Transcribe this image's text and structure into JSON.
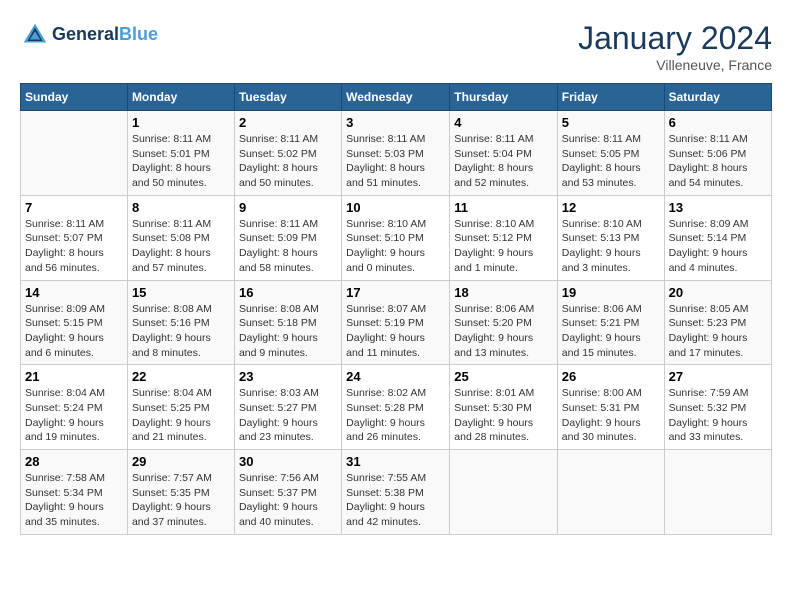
{
  "header": {
    "logo_line1": "General",
    "logo_line2": "Blue",
    "title": "January 2024",
    "location": "Villeneuve, France"
  },
  "columns": [
    "Sunday",
    "Monday",
    "Tuesday",
    "Wednesday",
    "Thursday",
    "Friday",
    "Saturday"
  ],
  "weeks": [
    [
      {
        "day": "",
        "sunrise": "",
        "sunset": "",
        "daylight": ""
      },
      {
        "day": "1",
        "sunrise": "Sunrise: 8:11 AM",
        "sunset": "Sunset: 5:01 PM",
        "daylight": "Daylight: 8 hours and 50 minutes."
      },
      {
        "day": "2",
        "sunrise": "Sunrise: 8:11 AM",
        "sunset": "Sunset: 5:02 PM",
        "daylight": "Daylight: 8 hours and 50 minutes."
      },
      {
        "day": "3",
        "sunrise": "Sunrise: 8:11 AM",
        "sunset": "Sunset: 5:03 PM",
        "daylight": "Daylight: 8 hours and 51 minutes."
      },
      {
        "day": "4",
        "sunrise": "Sunrise: 8:11 AM",
        "sunset": "Sunset: 5:04 PM",
        "daylight": "Daylight: 8 hours and 52 minutes."
      },
      {
        "day": "5",
        "sunrise": "Sunrise: 8:11 AM",
        "sunset": "Sunset: 5:05 PM",
        "daylight": "Daylight: 8 hours and 53 minutes."
      },
      {
        "day": "6",
        "sunrise": "Sunrise: 8:11 AM",
        "sunset": "Sunset: 5:06 PM",
        "daylight": "Daylight: 8 hours and 54 minutes."
      }
    ],
    [
      {
        "day": "7",
        "sunrise": "Sunrise: 8:11 AM",
        "sunset": "Sunset: 5:07 PM",
        "daylight": "Daylight: 8 hours and 56 minutes."
      },
      {
        "day": "8",
        "sunrise": "Sunrise: 8:11 AM",
        "sunset": "Sunset: 5:08 PM",
        "daylight": "Daylight: 8 hours and 57 minutes."
      },
      {
        "day": "9",
        "sunrise": "Sunrise: 8:11 AM",
        "sunset": "Sunset: 5:09 PM",
        "daylight": "Daylight: 8 hours and 58 minutes."
      },
      {
        "day": "10",
        "sunrise": "Sunrise: 8:10 AM",
        "sunset": "Sunset: 5:10 PM",
        "daylight": "Daylight: 9 hours and 0 minutes."
      },
      {
        "day": "11",
        "sunrise": "Sunrise: 8:10 AM",
        "sunset": "Sunset: 5:12 PM",
        "daylight": "Daylight: 9 hours and 1 minute."
      },
      {
        "day": "12",
        "sunrise": "Sunrise: 8:10 AM",
        "sunset": "Sunset: 5:13 PM",
        "daylight": "Daylight: 9 hours and 3 minutes."
      },
      {
        "day": "13",
        "sunrise": "Sunrise: 8:09 AM",
        "sunset": "Sunset: 5:14 PM",
        "daylight": "Daylight: 9 hours and 4 minutes."
      }
    ],
    [
      {
        "day": "14",
        "sunrise": "Sunrise: 8:09 AM",
        "sunset": "Sunset: 5:15 PM",
        "daylight": "Daylight: 9 hours and 6 minutes."
      },
      {
        "day": "15",
        "sunrise": "Sunrise: 8:08 AM",
        "sunset": "Sunset: 5:16 PM",
        "daylight": "Daylight: 9 hours and 8 minutes."
      },
      {
        "day": "16",
        "sunrise": "Sunrise: 8:08 AM",
        "sunset": "Sunset: 5:18 PM",
        "daylight": "Daylight: 9 hours and 9 minutes."
      },
      {
        "day": "17",
        "sunrise": "Sunrise: 8:07 AM",
        "sunset": "Sunset: 5:19 PM",
        "daylight": "Daylight: 9 hours and 11 minutes."
      },
      {
        "day": "18",
        "sunrise": "Sunrise: 8:06 AM",
        "sunset": "Sunset: 5:20 PM",
        "daylight": "Daylight: 9 hours and 13 minutes."
      },
      {
        "day": "19",
        "sunrise": "Sunrise: 8:06 AM",
        "sunset": "Sunset: 5:21 PM",
        "daylight": "Daylight: 9 hours and 15 minutes."
      },
      {
        "day": "20",
        "sunrise": "Sunrise: 8:05 AM",
        "sunset": "Sunset: 5:23 PM",
        "daylight": "Daylight: 9 hours and 17 minutes."
      }
    ],
    [
      {
        "day": "21",
        "sunrise": "Sunrise: 8:04 AM",
        "sunset": "Sunset: 5:24 PM",
        "daylight": "Daylight: 9 hours and 19 minutes."
      },
      {
        "day": "22",
        "sunrise": "Sunrise: 8:04 AM",
        "sunset": "Sunset: 5:25 PM",
        "daylight": "Daylight: 9 hours and 21 minutes."
      },
      {
        "day": "23",
        "sunrise": "Sunrise: 8:03 AM",
        "sunset": "Sunset: 5:27 PM",
        "daylight": "Daylight: 9 hours and 23 minutes."
      },
      {
        "day": "24",
        "sunrise": "Sunrise: 8:02 AM",
        "sunset": "Sunset: 5:28 PM",
        "daylight": "Daylight: 9 hours and 26 minutes."
      },
      {
        "day": "25",
        "sunrise": "Sunrise: 8:01 AM",
        "sunset": "Sunset: 5:30 PM",
        "daylight": "Daylight: 9 hours and 28 minutes."
      },
      {
        "day": "26",
        "sunrise": "Sunrise: 8:00 AM",
        "sunset": "Sunset: 5:31 PM",
        "daylight": "Daylight: 9 hours and 30 minutes."
      },
      {
        "day": "27",
        "sunrise": "Sunrise: 7:59 AM",
        "sunset": "Sunset: 5:32 PM",
        "daylight": "Daylight: 9 hours and 33 minutes."
      }
    ],
    [
      {
        "day": "28",
        "sunrise": "Sunrise: 7:58 AM",
        "sunset": "Sunset: 5:34 PM",
        "daylight": "Daylight: 9 hours and 35 minutes."
      },
      {
        "day": "29",
        "sunrise": "Sunrise: 7:57 AM",
        "sunset": "Sunset: 5:35 PM",
        "daylight": "Daylight: 9 hours and 37 minutes."
      },
      {
        "day": "30",
        "sunrise": "Sunrise: 7:56 AM",
        "sunset": "Sunset: 5:37 PM",
        "daylight": "Daylight: 9 hours and 40 minutes."
      },
      {
        "day": "31",
        "sunrise": "Sunrise: 7:55 AM",
        "sunset": "Sunset: 5:38 PM",
        "daylight": "Daylight: 9 hours and 42 minutes."
      },
      {
        "day": "",
        "sunrise": "",
        "sunset": "",
        "daylight": ""
      },
      {
        "day": "",
        "sunrise": "",
        "sunset": "",
        "daylight": ""
      },
      {
        "day": "",
        "sunrise": "",
        "sunset": "",
        "daylight": ""
      }
    ]
  ]
}
